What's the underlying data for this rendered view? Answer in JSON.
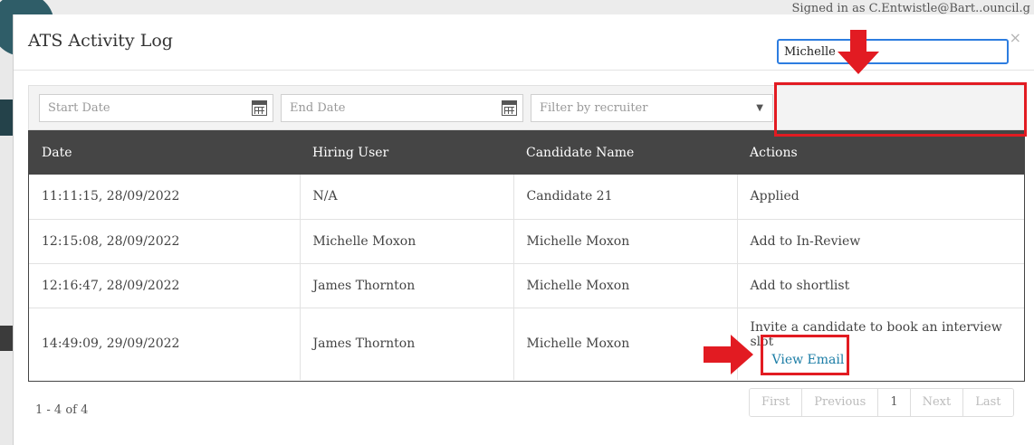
{
  "background": {
    "signed_in_text": "Signed in as C.Entwistle@Bart..ouncil.g"
  },
  "modal": {
    "title": "ATS Activity Log",
    "close_glyph": "×"
  },
  "filters": {
    "start_date_placeholder": "Start Date",
    "end_date_placeholder": "End Date",
    "recruiter_placeholder": "Filter by recruiter",
    "recruiter_caret": "▼",
    "search_value": "Michelle"
  },
  "table": {
    "headers": [
      "Date",
      "Hiring User",
      "Candidate Name",
      "Actions"
    ],
    "rows": [
      {
        "date": "11:11:15, 28/09/2022",
        "hiring_user": "N/A",
        "candidate": "Candidate 21",
        "action": "Applied"
      },
      {
        "date": "12:15:08, 28/09/2022",
        "hiring_user": "Michelle Moxon",
        "candidate": "Michelle Moxon",
        "action": "Add to In-Review"
      },
      {
        "date": "12:16:47, 28/09/2022",
        "hiring_user": "James Thornton",
        "candidate": "Michelle Moxon",
        "action": "Add to shortlist"
      },
      {
        "date": "14:49:09, 29/09/2022",
        "hiring_user": "James Thornton",
        "candidate": "Michelle Moxon",
        "action": "Invite a candidate to book an interview slot",
        "link": "View Email"
      }
    ]
  },
  "footer": {
    "record_count": "1 - 4 of 4",
    "pager": {
      "first": "First",
      "previous": "Previous",
      "current": "1",
      "next": "Next",
      "last": "Last"
    }
  },
  "colors": {
    "annotation_red": "#e21b22",
    "header_dark": "#454545",
    "link_blue": "#1a7ca5",
    "focus_blue": "#2d7de0"
  }
}
